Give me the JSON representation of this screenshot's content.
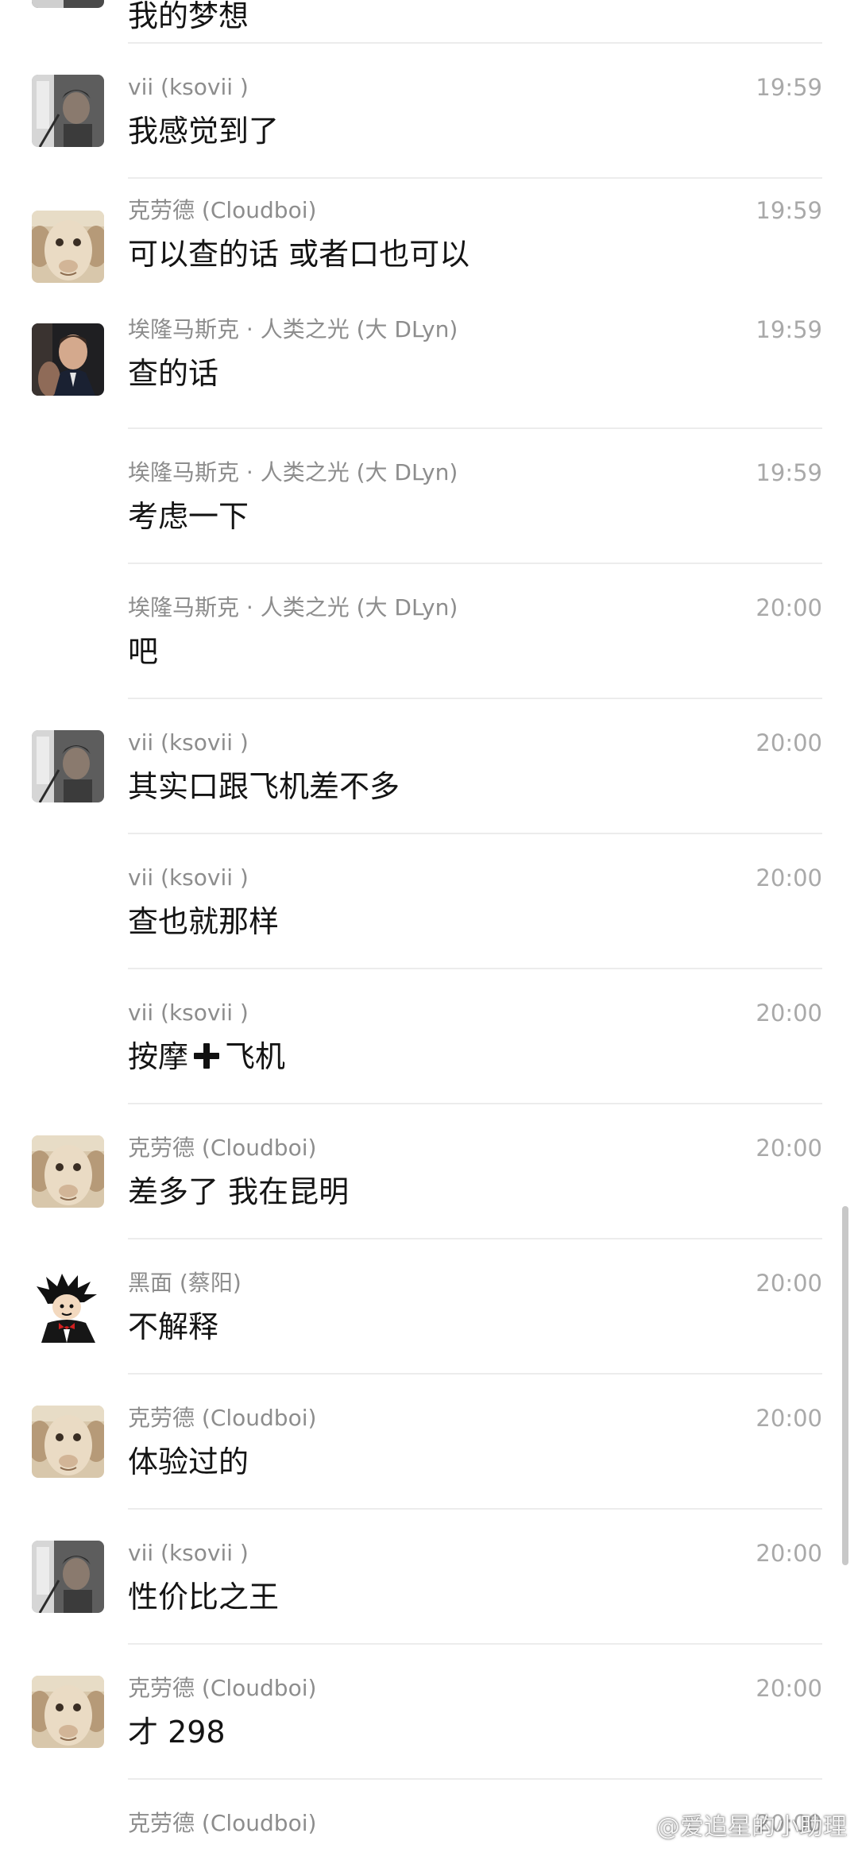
{
  "top_partial_message": {
    "text": "我的梦想"
  },
  "messages": [
    {
      "sender": "vii (ksovii )",
      "time": "19:59",
      "text": "我感觉到了",
      "avatar": "vii-avatar"
    },
    {
      "sender": "克劳德 (Cloudboi)",
      "time": "19:59",
      "text": "可以查的话 或者口也可以",
      "avatar": "cloudboi-avatar"
    },
    {
      "sender": "埃隆马斯克 · 人类之光 (大 DLyn)",
      "time": "19:59",
      "text": "查的话",
      "avatar": "elon-avatar"
    },
    {
      "sender": "埃隆马斯克 · 人类之光 (大 DLyn)",
      "time": "19:59",
      "text": "考虑一下",
      "avatar": ""
    },
    {
      "sender": "埃隆马斯克 · 人类之光 (大 DLyn)",
      "time": "20:00",
      "text": "吧",
      "avatar": ""
    },
    {
      "sender": "vii (ksovii )",
      "time": "20:00",
      "text": "其实口跟飞机差不多",
      "avatar": "vii-avatar"
    },
    {
      "sender": "vii (ksovii )",
      "time": "20:00",
      "text": "查也就那样",
      "avatar": ""
    },
    {
      "sender": "vii (ksovii )",
      "time": "20:00",
      "text_before": "按摩",
      "text_after": "飞机",
      "avatar": ""
    },
    {
      "sender": "克劳德 (Cloudboi)",
      "time": "20:00",
      "text": "差多了 我在昆明",
      "avatar": "cloudboi-avatar"
    },
    {
      "sender": "黑面 (蔡阳)",
      "time": "20:00",
      "text": "不解释",
      "avatar": "cartoon-avatar"
    },
    {
      "sender": "克劳德 (Cloudboi)",
      "time": "20:00",
      "text": "体验过的",
      "avatar": "cloudboi-avatar"
    },
    {
      "sender": "vii (ksovii )",
      "time": "20:00",
      "text": "性价比之王",
      "avatar": "vii-avatar"
    },
    {
      "sender": "克劳德 (Cloudboi)",
      "time": "20:00",
      "text": "才 298",
      "avatar": "cloudboi-avatar"
    },
    {
      "sender": "克劳德 (Cloudboi)",
      "time": "20:00",
      "text": "",
      "avatar": ""
    }
  ],
  "icons": {
    "plus": "heavy-plus-icon",
    "weibo": "weibo-logo-icon"
  },
  "watermark": {
    "text": "@爱追星的小助理"
  },
  "colors": {
    "background": "#ffffff",
    "sender": "#8d8d8d",
    "time": "#a9a9a9",
    "message_text": "#141414",
    "divider": "#ececec"
  }
}
